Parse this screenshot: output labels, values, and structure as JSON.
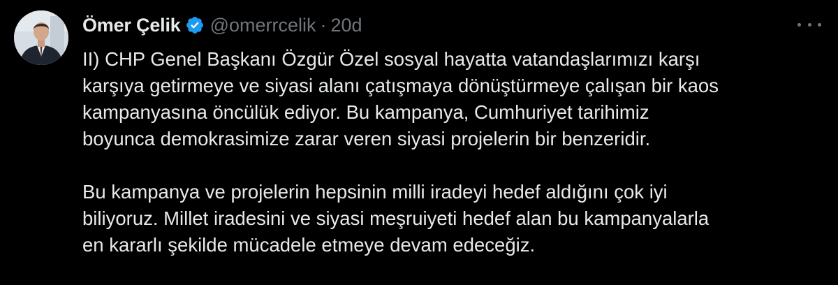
{
  "author": {
    "display_name": "Ömer Çelik",
    "handle": "@omerrcelik",
    "separator": "·",
    "time": "20d",
    "verified": true
  },
  "tweet": {
    "paragraph1": [
      "II) CHP Genel Başkanı Özgür Özel sosyal hayatta vatandaşlarımızı karşı",
      "karşıya getirmeye ve siyasi alanı çatışmaya dönüştürmeye çalışan bir kaos",
      "kampanyasına öncülük ediyor. Bu kampanya, Cumhuriyet tarihimiz",
      "boyunca demokrasimize zarar veren siyasi projelerin bir benzeridir."
    ],
    "paragraph2": [
      "Bu kampanya ve projelerin hepsinin milli iradeyi hedef aldığını çok iyi",
      "biliyoruz. Millet iradesini ve siyasi meşruiyeti hedef alan bu kampanyalarla",
      "en kararlı şekilde mücadele etmeye devam edeceğiz."
    ]
  },
  "icons": {
    "verified": "verified-badge-icon",
    "more": "more-options-icon",
    "avatar": "profile-photo"
  },
  "colors": {
    "background": "#000000",
    "text": "#e7e9ea",
    "secondary_text": "#71767b",
    "verified_badge": "#1d9bf0"
  }
}
